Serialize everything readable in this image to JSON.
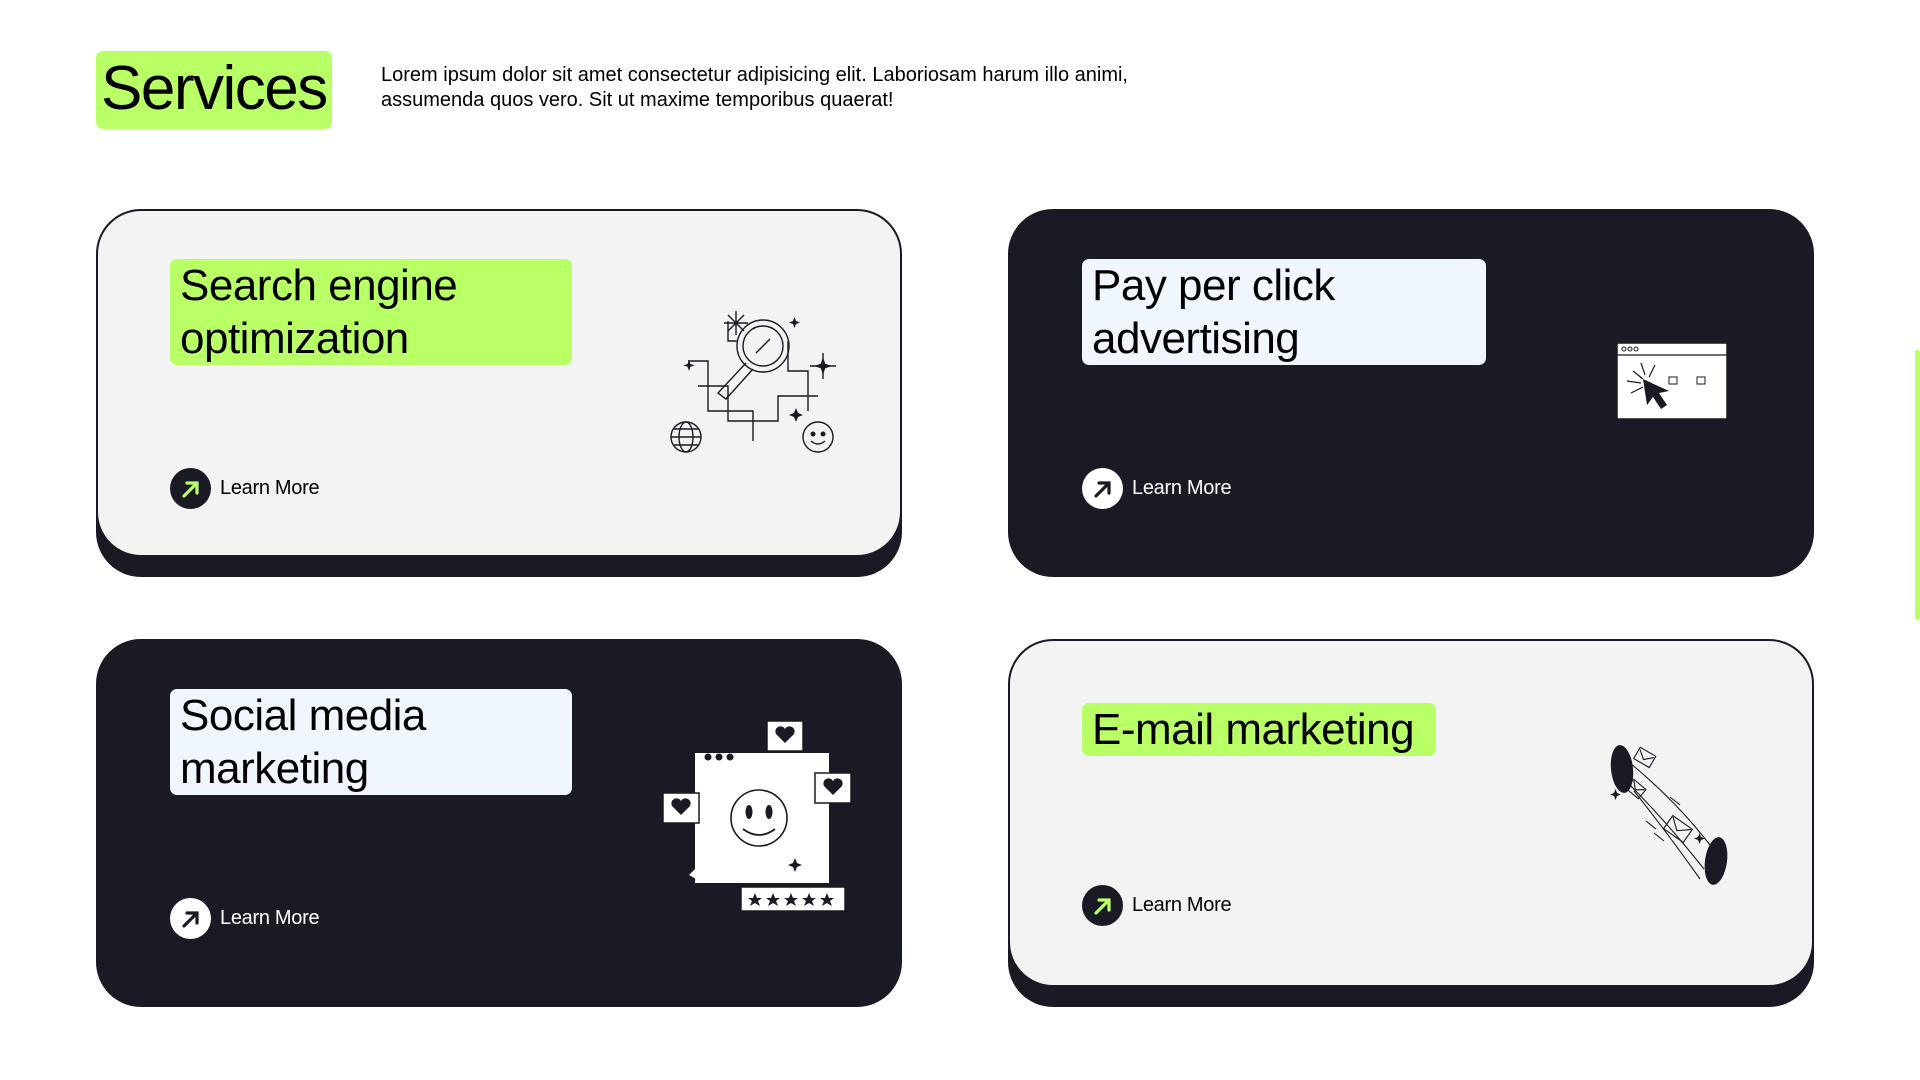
{
  "header": {
    "title": "Services",
    "description": "Lorem ipsum dolor sit amet consectetur adipisicing elit. Laboriosam harum illo animi, assumenda quos vero. Sit ut maxime temporibus quaerat!"
  },
  "cards": [
    {
      "title_line1": "Search engine",
      "title_line2": "optimization",
      "link": "Learn More",
      "illustration": "seo-magnifier-icon"
    },
    {
      "title_line1": "Pay per click",
      "title_line2": "advertising",
      "link": "Learn More",
      "illustration": "browser-cursor-icon"
    },
    {
      "title_line1": "Social media",
      "title_line2": "marketing",
      "link": "Learn More",
      "illustration": "social-smiley-icon"
    },
    {
      "title_line1": "E-mail marketing",
      "link": "Learn More",
      "illustration": "email-flow-icon"
    }
  ],
  "colors": {
    "accent": "#b9ff66",
    "dark": "#191a23",
    "light": "#f3f3f3",
    "label_bg": "#f0f6fd"
  }
}
